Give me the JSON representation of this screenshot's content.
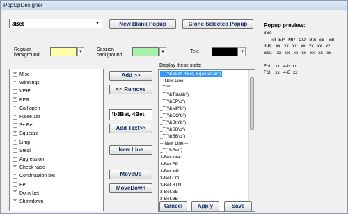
{
  "window": {
    "title": "PopUpDesigner"
  },
  "popup_select": {
    "value": "3Bet"
  },
  "buttons": {
    "new_blank": "New Blank Popup",
    "clone_selected": "Clone Selected Popup",
    "add": "Add >>",
    "remove": "<< Remove",
    "add_text": "Add Text>>",
    "new_line": "New Line",
    "move_up": "MoveUp",
    "move_down": "MoveDown",
    "cancel": "Cancel",
    "apply": "Apply",
    "save": "Save"
  },
  "colors": {
    "regular_label": "Regular background",
    "regular_value": "#ffffa8",
    "session_label": "Session background",
    "session_value": "#a8f0a8",
    "text_label": "Text",
    "text_value": "#000000"
  },
  "stats_tree": [
    "Misc",
    "Winnings",
    "VPIP",
    "PFR",
    "Call open",
    "Raise 1st",
    "3+ Bet",
    "Squeeze",
    "Limp",
    "Steal",
    "Aggression",
    "Check raise",
    "Continuation bet",
    "Bet",
    "Donk bet",
    "Showdown"
  ],
  "text_input": {
    "value": "\\b3Bet, 4Bet,"
  },
  "display_label": "Display these stats:",
  "display_list": [
    "_T(\"\\b3Bet, 4Bet, Squeeze\\b\")",
    "---New Line---",
    "_T(\"\")",
    "_T(\"\\bTotal\\b\")",
    "_T(\"\\bEP\\b\")",
    "_T(\"\\bMP\\b\")",
    "_T(\"\\bCO\\b\")",
    "_T(\"\\bBtn\\b\")",
    "_T(\"\\bSB\\b\")",
    "_T(\"\\bBB\\b\")",
    "---New Line---",
    "_T(\"3-Bet\")",
    "3-Bet.total",
    "3-Bet.EP",
    "3-Bet.MP",
    "3-Bet.CO",
    "3-Bet.BTN",
    "3-Bet.SB",
    "3-Bet.BB",
    "---New Line---"
  ],
  "preview": {
    "title": "Popup preview:",
    "rows": [
      "3Be",
      "     Tot  EP   MP   CO   Btn  SB   BB",
      "3-B    xx   xx   xx   xx   xx   xx   xx",
      "Squ    xx   xx   xx   xx   xx   xx   xx",
      "",
      "Fol    xx   4-b  xx",
      "Fol    xx   4-B  xx"
    ]
  }
}
